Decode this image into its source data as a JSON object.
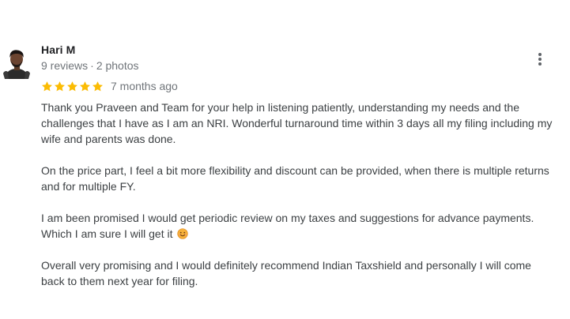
{
  "review": {
    "author": {
      "name": "Hari M",
      "reviews_count": "9 reviews",
      "photos_count": "2 photos",
      "separator": "·"
    },
    "rating": {
      "stars": 5,
      "out_of": 5,
      "star_color": "#fbbc04"
    },
    "date": "7 months ago",
    "more_icon": "more-vert-icon",
    "body": {
      "paragraphs": [
        {
          "lines": [
            "Thank you Praveen and Team for your help in listening patiently, understanding my needs and the",
            "challenges that I have as I am an NRI. Wonderful turnaround time within 3 days all my filing including my",
            "wife and parents was done."
          ]
        },
        {
          "lines": [
            "On the price part, I feel a bit more flexibility and discount can be provided, when there is multiple returns",
            "and for multiple FY."
          ]
        },
        {
          "lines": [
            "I am been promised I would get periodic review on my taxes and suggestions for advance payments.",
            "Which I am sure I will get it"
          ],
          "emoji": "smiling-face-emoji"
        },
        {
          "lines": [
            "Overall very promising and I would definitely recommend Indian Taxshield and personally I will come",
            "back to them next year for filing."
          ]
        }
      ]
    }
  },
  "colors": {
    "name": "#202124",
    "meta": "#70757a",
    "body": "#3c4043",
    "star": "#fbbc04"
  }
}
